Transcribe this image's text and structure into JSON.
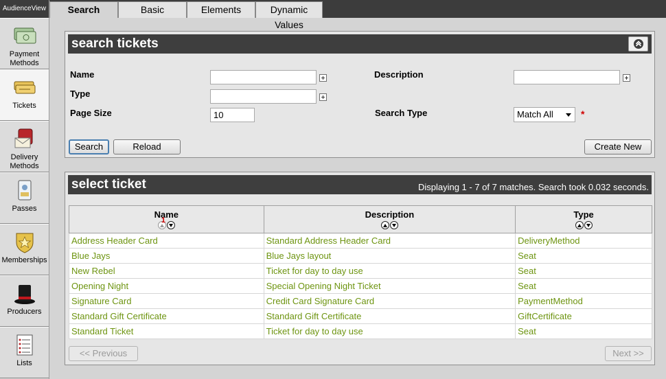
{
  "app": {
    "title": "AudienceView"
  },
  "sidebar": {
    "items": [
      {
        "label": "Payment Methods",
        "icon": "payment-methods-icon"
      },
      {
        "label": "Tickets",
        "icon": "tickets-icon"
      },
      {
        "label": "Delivery Methods",
        "icon": "delivery-methods-icon"
      },
      {
        "label": "Passes",
        "icon": "passes-icon"
      },
      {
        "label": "Memberships",
        "icon": "memberships-icon"
      },
      {
        "label": "Producers",
        "icon": "producers-icon"
      },
      {
        "label": "Lists",
        "icon": "lists-icon"
      }
    ],
    "active": "Tickets"
  },
  "tabs": [
    {
      "label": "Search",
      "active": true
    },
    {
      "label": "Basic",
      "active": false
    },
    {
      "label": "Elements",
      "active": false
    },
    {
      "label": "Dynamic Values",
      "active": false
    }
  ],
  "search_panel": {
    "title": "search tickets",
    "fields": {
      "name": {
        "label": "Name",
        "value": ""
      },
      "type": {
        "label": "Type",
        "value": ""
      },
      "page_size": {
        "label": "Page Size",
        "value": "10"
      },
      "description": {
        "label": "Description",
        "value": ""
      },
      "search_type": {
        "label": "Search Type",
        "value": "Match All",
        "required_marker": "*"
      }
    },
    "buttons": {
      "search": "Search",
      "reload": "Reload",
      "create_new": "Create New"
    }
  },
  "results_panel": {
    "title": "select ticket",
    "status": "Displaying 1 - 7 of 7 matches. Search took 0.032 seconds.",
    "columns": [
      "Name",
      "Description",
      "Type"
    ],
    "sort_marker": "1",
    "rows": [
      [
        "Address Header Card",
        "Standard Address Header Card",
        "DeliveryMethod"
      ],
      [
        "Blue Jays",
        "Blue Jays layout",
        "Seat"
      ],
      [
        "New Rebel",
        "Ticket for day to day use",
        "Seat"
      ],
      [
        "Opening Night",
        "Special Opening Night Ticket",
        "Seat"
      ],
      [
        "Signature Card",
        "Credit Card Signature Card",
        "PaymentMethod"
      ],
      [
        "Standard Gift Certificate",
        "Standard Gift Certificate",
        "GiftCertificate"
      ],
      [
        "Standard Ticket",
        "Ticket for day to day use",
        "Seat"
      ]
    ],
    "pager": {
      "previous": "<< Previous",
      "next": "Next >>"
    }
  },
  "colors": {
    "header_dark": "#3e3e3e",
    "link_green": "#6d9410",
    "required_red": "#d00000"
  }
}
